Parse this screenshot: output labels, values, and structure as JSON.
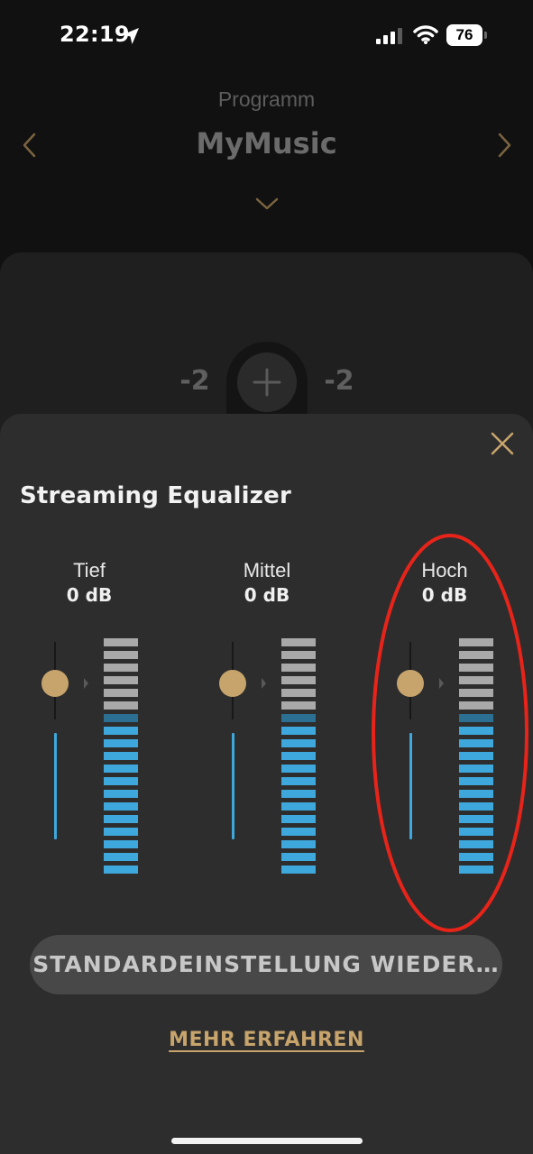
{
  "status_bar": {
    "time": "22:19",
    "battery": "76",
    "icons": [
      "location-arrow-icon",
      "cellular-signal-icon",
      "wifi-icon",
      "battery-icon"
    ]
  },
  "program": {
    "label": "Programm",
    "name": "MyMusic",
    "icons": [
      "chevron-left-icon",
      "chevron-right-icon",
      "chevron-down-icon"
    ]
  },
  "volume": {
    "left": "-2",
    "right": "-2",
    "add_icon": "plus-icon"
  },
  "equalizer": {
    "title": "Streaming Equalizer",
    "close_icon": "close-icon",
    "bands": [
      {
        "name": "Tief",
        "value": "0 dB",
        "level_db": 0
      },
      {
        "name": "Mittel",
        "value": "0 dB",
        "level_db": 0
      },
      {
        "name": "Hoch",
        "value": "0 dB",
        "level_db": 0
      }
    ],
    "meter": {
      "segments_total": 19,
      "segments_inactive": 6,
      "segments_marker": 1,
      "segments_active": 12
    },
    "reset_label": "STANDARDEINSTELLUNG WIEDER…",
    "learn_more_label": "MEHR ERFAHREN"
  },
  "annotation": {
    "type": "ellipse",
    "color": "#e8241a",
    "target": "Hoch"
  },
  "colors": {
    "accent": "#c7a46b",
    "active_level": "#3ea7dc",
    "marker_level": "#2b6f93",
    "inactive_level": "#a9a9a9",
    "sheet_background": "#2d2d2d"
  }
}
